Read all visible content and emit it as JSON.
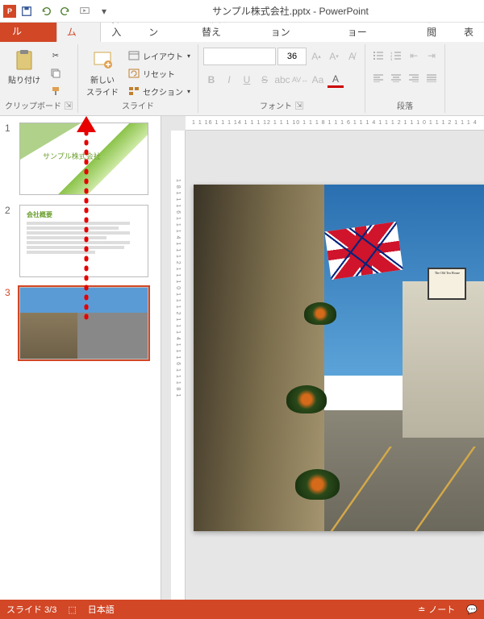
{
  "title": "サンプル株式会社.pptx - PowerPoint",
  "tabs": {
    "file": "ファイル",
    "home": "ホーム",
    "insert": "挿入",
    "design": "デザイン",
    "transitions": "画面切り替え",
    "animations": "アニメーション",
    "slideshow": "スライド ショー",
    "review": "校閲",
    "view": "表"
  },
  "ribbon": {
    "clipboard": {
      "label": "クリップボード",
      "paste": "貼り付け"
    },
    "slides": {
      "label": "スライド",
      "new_slide": "新しい\nスライド",
      "layout": "レイアウト",
      "reset": "リセット",
      "section": "セクション"
    },
    "font": {
      "label": "フォント",
      "size": "36",
      "bold": "B",
      "italic": "I",
      "underline": "U",
      "strike": "S"
    },
    "paragraph": {
      "label": "段落"
    }
  },
  "ruler_h": "1 1 16 1 1 1 14 1 1 1 12 1 1 1 10 1 1 1 8 1 1 1 6 1 1 1 4 1 1 1 2 1 1 1 0 1 1 1 2 1 1 1 4",
  "ruler_v": "1 8 1 1 1 6 1 1 1 4 1 1 1 2 1 1 1 0 1 1 1 2 1 1 1 4 1 1 1 6 1 1 1 8 1",
  "thumbs": {
    "s1_title": "サンプル株式会社",
    "s2_title": "会社概要"
  },
  "sign_text": "The Old Tea House",
  "status": {
    "slide": "スライド 3/3",
    "lang": "日本語",
    "notes": "ノート"
  }
}
